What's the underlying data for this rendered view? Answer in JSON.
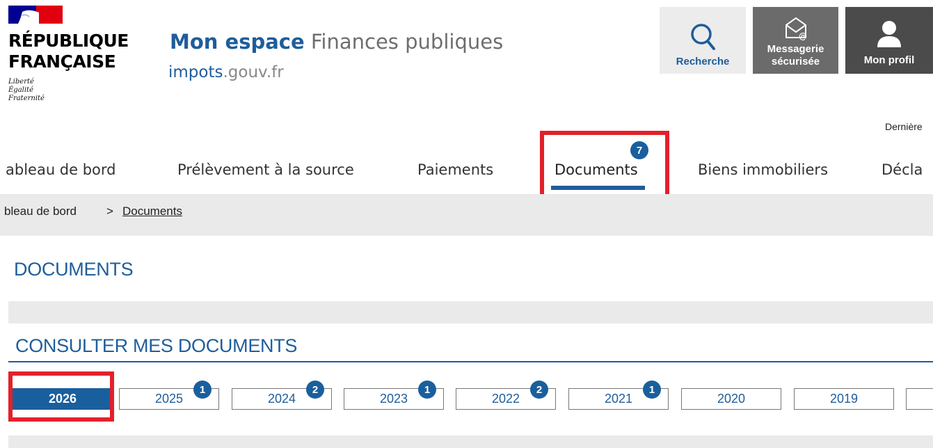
{
  "logo": {
    "line1": "RÉPUBLIQUE",
    "line2": "FRANÇAISE",
    "motto": [
      "Liberté",
      "Égalité",
      "Fraternité"
    ]
  },
  "site": {
    "title_strong": "Mon espace",
    "title_rest": " Finances publiques",
    "sub_hl": "impots",
    "sub_rest": ".gouv.fr"
  },
  "header": {
    "search_label": "Recherche",
    "messaging_label_1": "Messagerie",
    "messaging_label_2": "sécurisée",
    "profile_label": "Mon profil",
    "last_login_truncated": "Dernière"
  },
  "nav": {
    "items": [
      {
        "label": "ableau de bord"
      },
      {
        "label": "Prélèvement à la source"
      },
      {
        "label": "Paiements"
      },
      {
        "label": "Documents",
        "badge": "7",
        "active": true
      },
      {
        "label": "Biens immobiliers"
      },
      {
        "label": "Décla"
      }
    ]
  },
  "breadcrumb": {
    "parent": "bleau de bord",
    "separator": ">",
    "current": "Documents"
  },
  "page": {
    "title": "DOCUMENTS",
    "section_title": "CONSULTER MES DOCUMENTS"
  },
  "years": [
    {
      "label": "2026",
      "active": true,
      "badge": ""
    },
    {
      "label": "2025",
      "badge": "1"
    },
    {
      "label": "2024",
      "badge": "2"
    },
    {
      "label": "2023",
      "badge": "1"
    },
    {
      "label": "2022",
      "badge": "2"
    },
    {
      "label": "2021",
      "badge": "1"
    },
    {
      "label": "2020",
      "badge": ""
    },
    {
      "label": "2019",
      "badge": ""
    }
  ],
  "colors": {
    "accent": "#1f5d9b",
    "highlight": "#e3202a",
    "active_tab": "#1a5f9d"
  }
}
